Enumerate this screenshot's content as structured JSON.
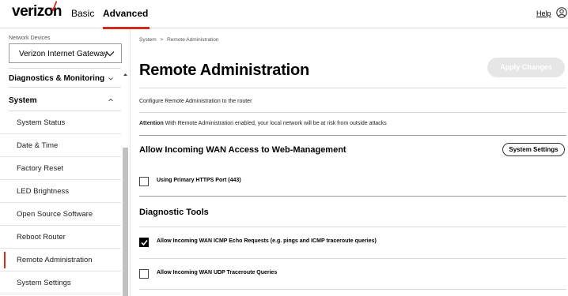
{
  "header": {
    "logo_text": "verizon",
    "tabs": [
      {
        "label": "Basic"
      },
      {
        "label": "Advanced"
      }
    ],
    "help_label": "Help",
    "accent_color": "#d52b1e"
  },
  "sidebar": {
    "network_devices_label": "Network Devices",
    "device_select_value": "Verizon Internet Gateway",
    "sections": [
      {
        "label": "Diagnostics & Monitoring"
      },
      {
        "label": "System"
      }
    ],
    "items": [
      {
        "label": "System Status"
      },
      {
        "label": "Date & Time"
      },
      {
        "label": "Factory Reset"
      },
      {
        "label": "LED Brightness"
      },
      {
        "label": "Open Source Software"
      },
      {
        "label": "Reboot Router"
      },
      {
        "label": "Remote Administration"
      },
      {
        "label": "System Settings"
      }
    ]
  },
  "main": {
    "breadcrumb": {
      "root": "System",
      "separator": ">",
      "current": "Remote Administration"
    },
    "title": "Remote Administration",
    "apply_button_label": "Apply Changes",
    "description": "Configure Remote Administration to the router",
    "attention_label": "Attention",
    "attention_text": "With Remote Administration enabled, your local network will be at risk from outside attacks",
    "wan_section_title": "Allow Incoming WAN Access to Web-Management",
    "system_settings_button_label": "System Settings",
    "https_port_label": "Using Primary HTTPS Port (443)",
    "https_port_checked": false,
    "diagnostic_title": "Diagnostic Tools",
    "icmp_label": "Allow Incoming WAN ICMP Echo Requests (e.g. pings and ICMP traceroute queries)",
    "icmp_checked": true,
    "udp_label": "Allow Incoming WAN UDP Traceroute Queries",
    "udp_checked": false
  }
}
